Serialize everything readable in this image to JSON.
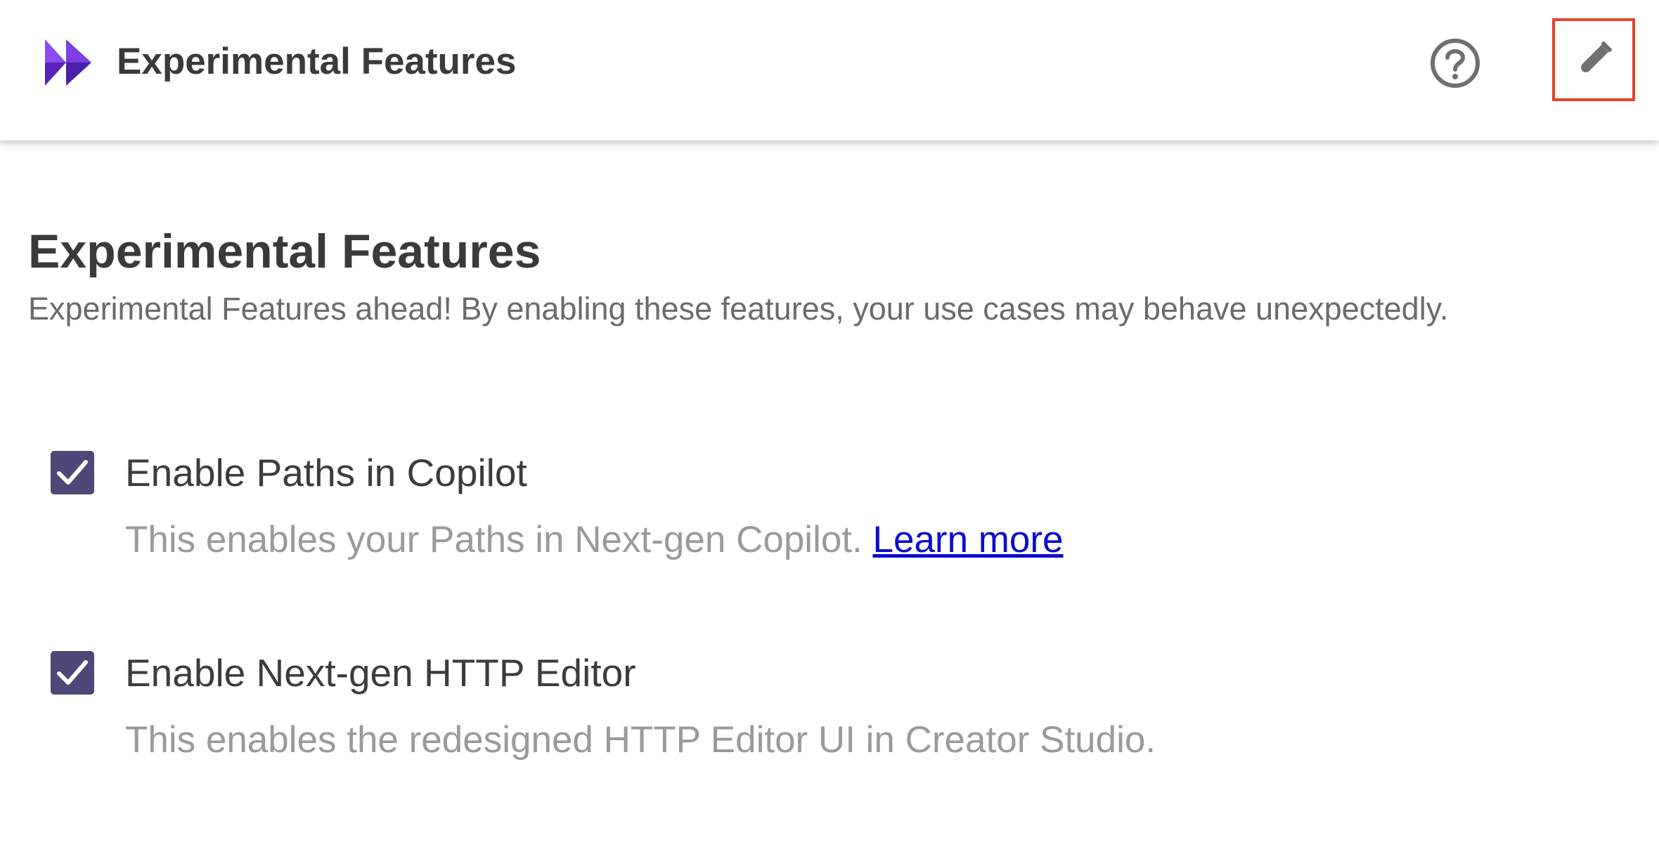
{
  "header": {
    "title": "Experimental Features",
    "logo_icon": "app-logo-icon",
    "help_icon": "help-circle-icon",
    "lab_icon": "test-tube-icon",
    "accent": "#e0442c",
    "logo_colors": [
      "#7b3fe4",
      "#4b1fa8"
    ]
  },
  "page": {
    "title": "Experimental Features",
    "subtitle": "Experimental Features ahead! By enabling these features, your use cases may behave unexpectedly."
  },
  "features": [
    {
      "label": "Enable Paths in Copilot",
      "description": "This enables your Paths in Next-gen Copilot. ",
      "link_text": "Learn more",
      "checked": true
    },
    {
      "label": "Enable Next-gen HTTP Editor",
      "description": "This enables the redesigned HTTP Editor UI in Creator Studio.",
      "checked": true
    }
  ],
  "colors": {
    "checkbox": "#4c4877",
    "link": "#0b0bd0"
  }
}
